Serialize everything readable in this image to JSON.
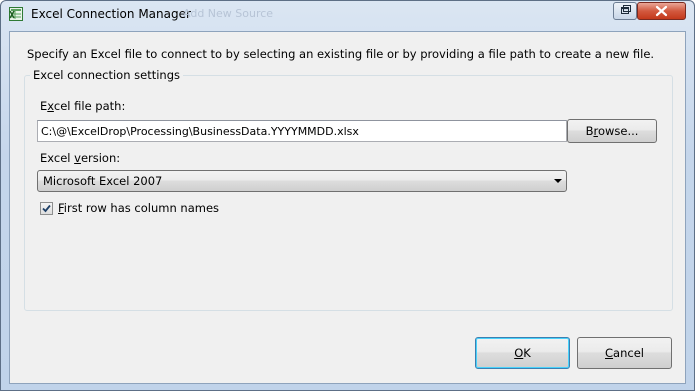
{
  "window": {
    "title": "Excel Connection Manager",
    "background_title": "Add New Source",
    "controls": {
      "restore_icon": "restore-icon",
      "close_icon": "close-icon"
    },
    "app_icon": "excel-icon"
  },
  "dialog": {
    "instruction": "Specify an Excel file to connect to by selecting an existing file or by providing a file path to create a new file.",
    "group_title": "Excel connection settings",
    "file_path": {
      "label_pre": "E",
      "label_access": "x",
      "label_post": "cel file path:",
      "value": "C:\\@\\ExcelDrop\\Processing\\BusinessData.YYYYMMDD.xlsx"
    },
    "browse_button": {
      "pre": "B",
      "access": "r",
      "post": "owse..."
    },
    "version": {
      "label_pre": "Excel ",
      "label_access": "v",
      "label_post": "ersion:",
      "selected": "Microsoft Excel 2007",
      "arrow_icon": "dropdown-arrow-icon"
    },
    "first_row_header": {
      "checked": true,
      "label_access": "F",
      "label_post": "irst row has column names"
    },
    "ok_button": {
      "access": "O",
      "post": "K"
    },
    "cancel_button": {
      "pre": "",
      "access": "C",
      "post": "ancel"
    }
  },
  "colors": {
    "frame": "#c5d6eb",
    "client": "#f0f0f0",
    "close_button": "#c4391c",
    "default_button_border": "#3c7fb1"
  }
}
